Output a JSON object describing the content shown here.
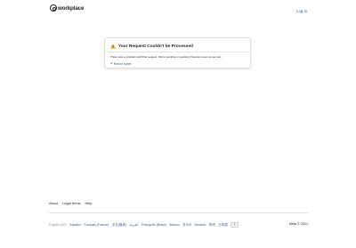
{
  "header": {
    "logo_text": "workplace",
    "login_label": "Log in"
  },
  "error_card": {
    "title": "Your Request Couldn't be Processed",
    "message": "There was a problem with this request. We're working on getting it fixed as soon as we can.",
    "return_label": "Return home",
    "icon": "warning-icon",
    "warning_color": "#f7b928"
  },
  "footer": {
    "links": [
      "About",
      "Legal terms",
      "Help"
    ],
    "current_language": "English (US)",
    "languages": [
      "Español",
      "Français (France)",
      "中文(简体)",
      "العربية",
      "Português (Brasil)",
      "Italiano",
      "한국어",
      "Deutsch",
      "हिन्दी",
      "日本語"
    ],
    "more_languages_label": "+",
    "copyright": "Meta © 2021"
  },
  "colors": {
    "link": "#385898",
    "text": "#1c1e21",
    "muted": "#90949c"
  }
}
